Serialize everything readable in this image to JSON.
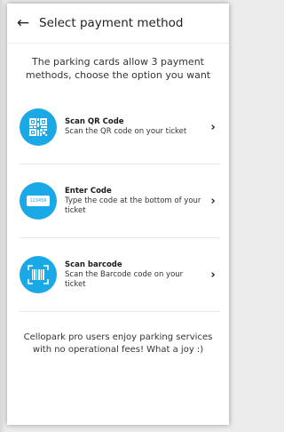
{
  "header": {
    "back_glyph": "←",
    "title": "Select payment method"
  },
  "intro": "The parking cards allow 3 payment methods, choose the option you want",
  "options": [
    {
      "title": "Scan QR Code",
      "description": "Scan the QR code on your ticket",
      "icon": "qr-code-icon"
    },
    {
      "title": "Enter Code",
      "description": "Type the code at the bottom of your ticket",
      "icon": "keypad-code-icon",
      "icon_text": "123456"
    },
    {
      "title": "Scan barcode",
      "description": "Scan the Barcode code on your ticket",
      "icon": "barcode-icon"
    }
  ],
  "chevron_glyph": "›",
  "footer": "Cellopark pro users enjoy parking services with no operational fees! What a joy :)",
  "colors": {
    "accent": "#1aa9e6"
  }
}
